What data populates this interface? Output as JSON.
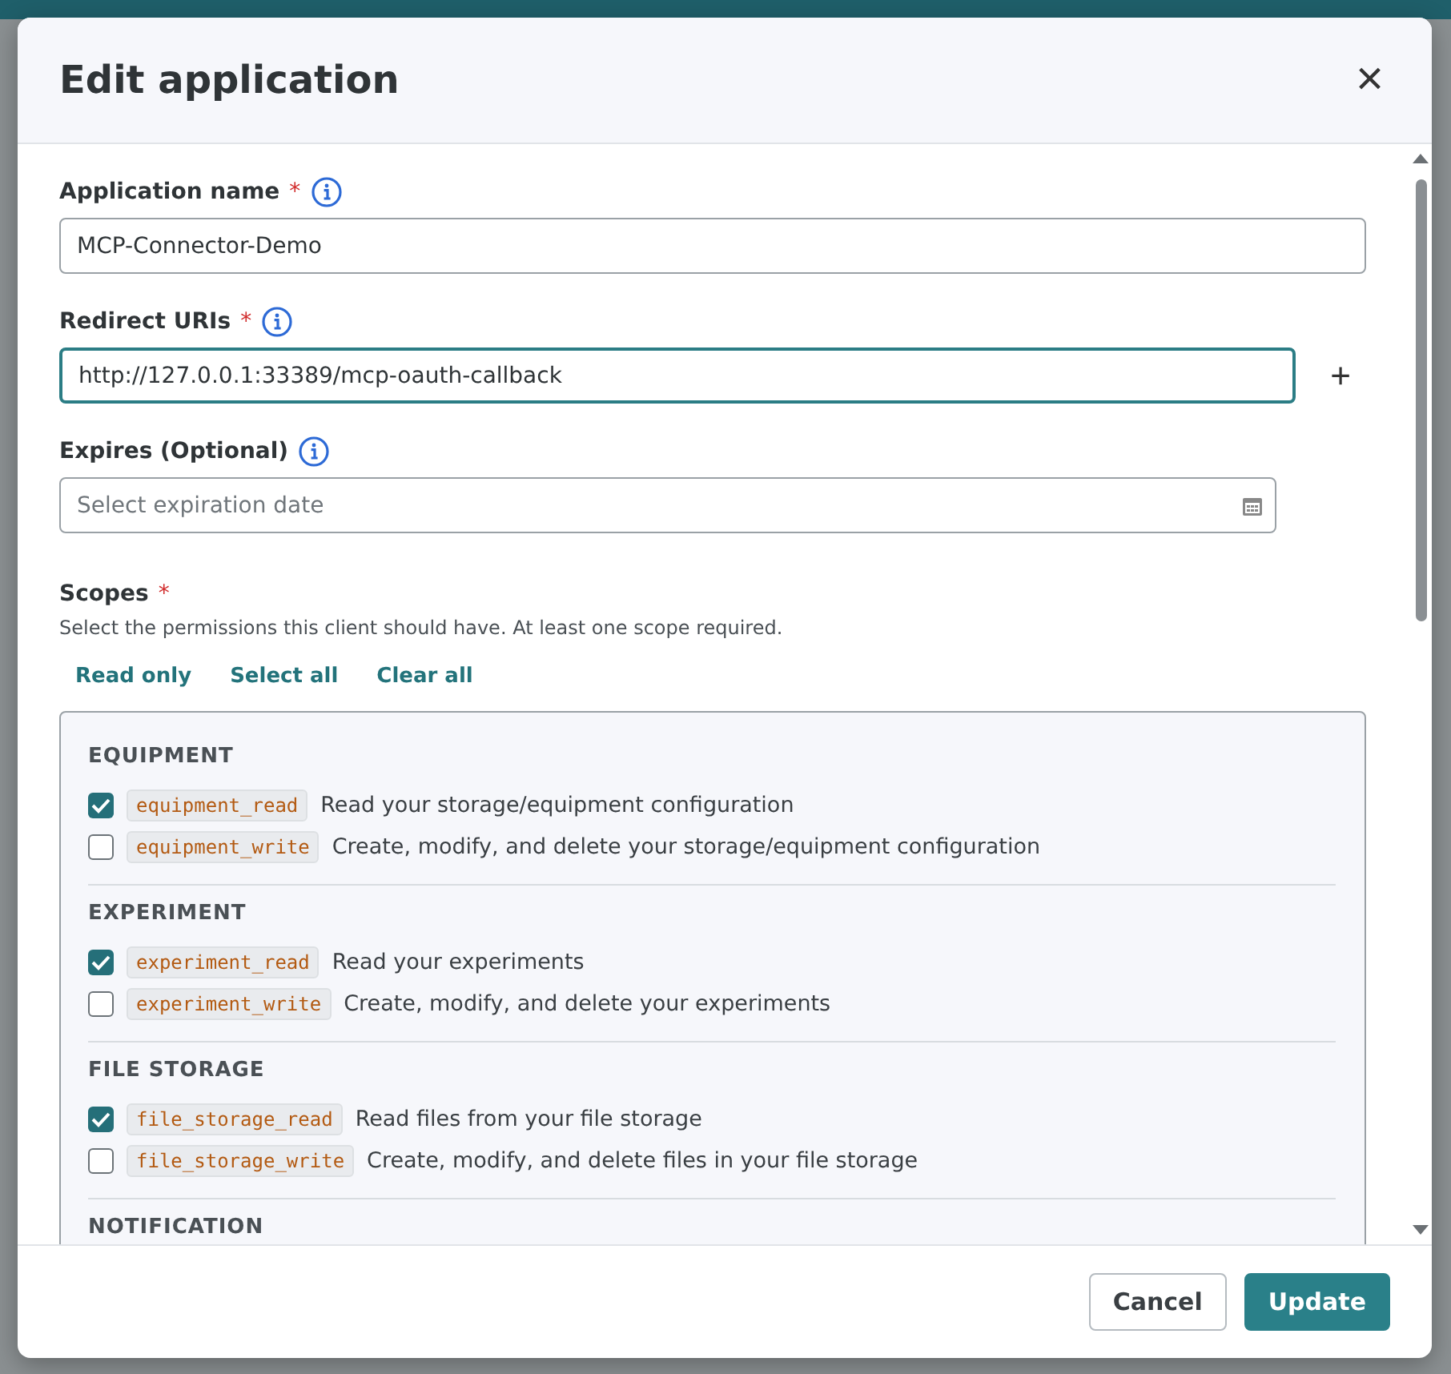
{
  "dialog": {
    "title": "Edit application",
    "close": "×"
  },
  "fields": [
    {
      "kind": "text",
      "label": "Application name",
      "required": "*",
      "value": "MCP-Connector-Demo",
      "focused": false
    },
    {
      "kind": "uri",
      "label": "Redirect URIs",
      "required": "*",
      "value": "http://127.0.0.1:33389/mcp-oauth-callback",
      "focused": true,
      "add": "+"
    },
    {
      "kind": "date",
      "label": "Expires (Optional)",
      "placeholder": "Select expiration date",
      "focused": false
    }
  ],
  "scopes": {
    "label": "Scopes",
    "required": "*",
    "hint": "Select the permissions this client should have. At least one scope required.",
    "actions": [
      "Read only",
      "Select all",
      "Clear all"
    ],
    "groups": [
      {
        "title": "EQUIPMENT",
        "items": [
          {
            "code": "equipment_read",
            "text": "Read your storage/equipment configuration",
            "checked": true
          },
          {
            "code": "equipment_write",
            "text": "Create, modify, and delete your storage/equipment configuration",
            "checked": false
          }
        ]
      },
      {
        "title": "EXPERIMENT",
        "items": [
          {
            "code": "experiment_read",
            "text": "Read your experiments",
            "checked": true
          },
          {
            "code": "experiment_write",
            "text": "Create, modify, and delete your experiments",
            "checked": false
          }
        ]
      },
      {
        "title": "FILE STORAGE",
        "items": [
          {
            "code": "file_storage_read",
            "text": "Read files from your file storage",
            "checked": true
          },
          {
            "code": "file_storage_write",
            "text": "Create, modify, and delete files in your file storage",
            "checked": false
          }
        ]
      },
      {
        "title": "NOTIFICATION"
      }
    ]
  },
  "buttons": [
    {
      "label": "Cancel",
      "kind": "secondary"
    },
    {
      "label": "Update",
      "kind": "primary"
    }
  ]
}
